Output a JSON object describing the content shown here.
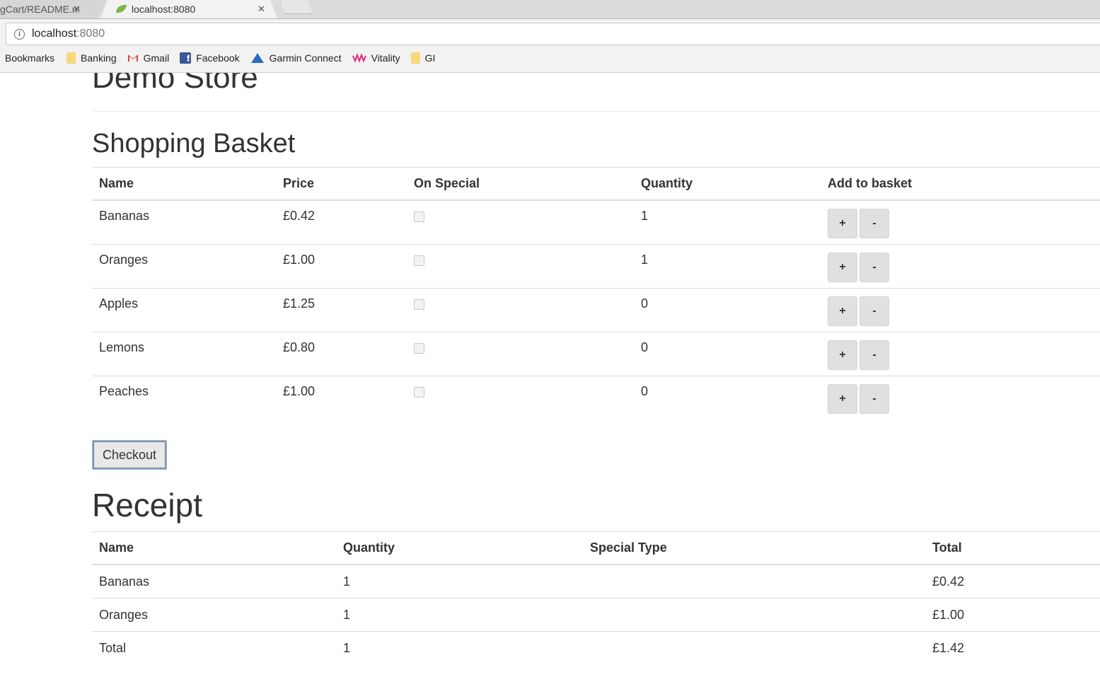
{
  "browser": {
    "tabs": [
      {
        "title": "gCart/README.md",
        "active": false
      },
      {
        "title": "localhost:8080",
        "active": true
      }
    ],
    "address": {
      "host": "localhost",
      "port": ":8080"
    },
    "bookmarks": [
      {
        "label": "Bookmarks",
        "icon": "none"
      },
      {
        "label": "Banking",
        "icon": "folder-icon"
      },
      {
        "label": "Gmail",
        "icon": "gmail-icon"
      },
      {
        "label": "Facebook",
        "icon": "facebook-icon"
      },
      {
        "label": "Garmin Connect",
        "icon": "garmin-icon"
      },
      {
        "label": "Vitality",
        "icon": "vitality-icon"
      },
      {
        "label": "GI",
        "icon": "folder-icon"
      }
    ]
  },
  "page": {
    "store_title": "Demo Store",
    "basket_heading": "Shopping Basket",
    "basket_columns": [
      "Name",
      "Price",
      "On Special",
      "Quantity",
      "Add to basket"
    ],
    "basket_rows": [
      {
        "name": "Bananas",
        "price": "£0.42",
        "on_special": false,
        "quantity": "1"
      },
      {
        "name": "Oranges",
        "price": "£1.00",
        "on_special": false,
        "quantity": "1"
      },
      {
        "name": "Apples",
        "price": "£1.25",
        "on_special": false,
        "quantity": "0"
      },
      {
        "name": "Lemons",
        "price": "£0.80",
        "on_special": false,
        "quantity": "0"
      },
      {
        "name": "Peaches",
        "price": "£1.00",
        "on_special": false,
        "quantity": "0"
      }
    ],
    "add_label": "+",
    "remove_label": "-",
    "checkout_label": "Checkout",
    "receipt_heading": "Receipt",
    "receipt_columns": [
      "Name",
      "Quantity",
      "Special Type",
      "Total"
    ],
    "receipt_rows": [
      {
        "name": "Bananas",
        "quantity": "1",
        "special": "",
        "total": "£0.42"
      },
      {
        "name": "Oranges",
        "quantity": "1",
        "special": "",
        "total": "£1.00"
      },
      {
        "name": "Total",
        "quantity": "1",
        "special": "",
        "total": "£1.42"
      }
    ]
  }
}
